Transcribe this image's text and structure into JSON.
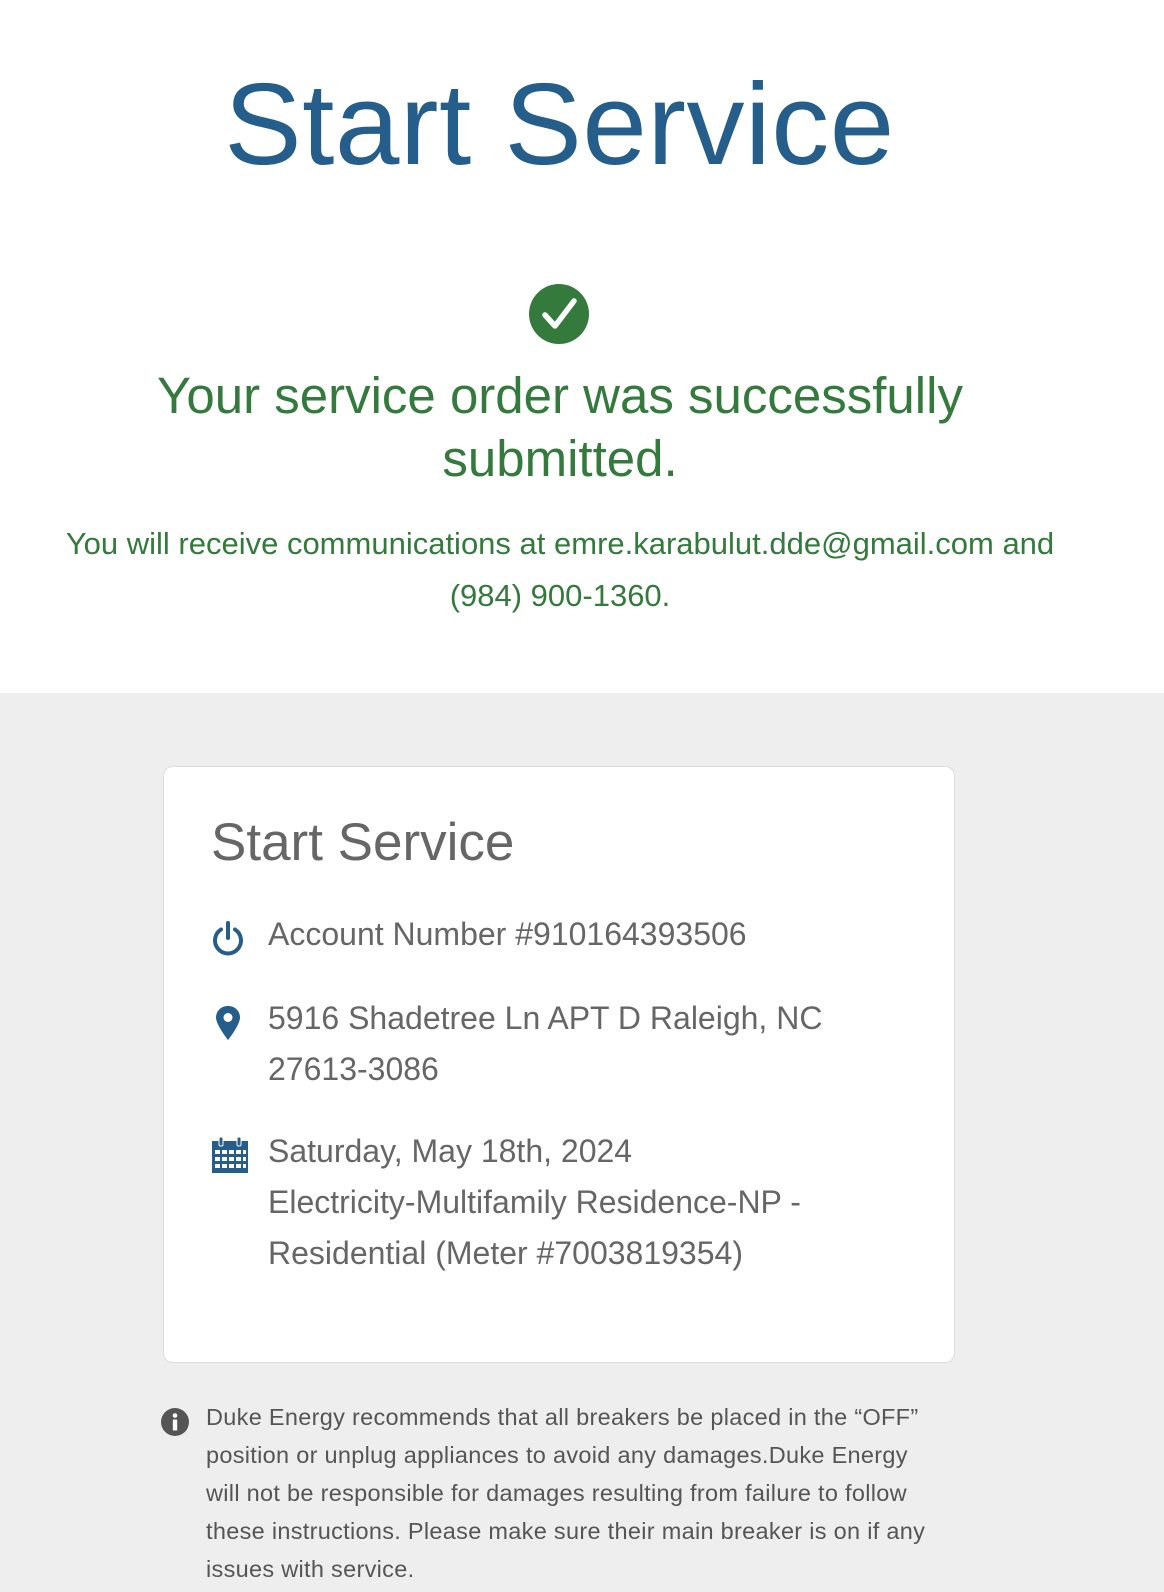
{
  "header": {
    "title": "Start Service"
  },
  "confirmation": {
    "icon": "check-circle-icon",
    "heading": "Your service order was successfully submitted.",
    "communications": "You will receive communications at emre.karabulut.dde@gmail.com and (984) 900-1360."
  },
  "summary_card": {
    "title": "Start Service",
    "account": {
      "icon": "power-icon",
      "text": "Account Number #910164393506"
    },
    "address": {
      "icon": "location-pin-icon",
      "text": "5916 Shadetree Ln APT D Raleigh, NC 27613-3086"
    },
    "schedule": {
      "icon": "calendar-icon",
      "date": "Saturday, May 18th, 2024",
      "service": "Electricity-Multifamily Residence-NP - Residential (Meter #7003819354)"
    }
  },
  "notice": {
    "icon": "info-icon",
    "text": "Duke Energy recommends that all breakers be placed in the “OFF” position or unplug appliances to avoid any damages.Duke Energy will not be responsible for damages resulting from failure to follow these instructions. Please make sure their main breaker is on if any issues with service."
  },
  "colors": {
    "brand_blue": "#255d8b",
    "success_green": "#347a3c",
    "text_gray": "#666666",
    "background_gray": "#eeeeee"
  }
}
